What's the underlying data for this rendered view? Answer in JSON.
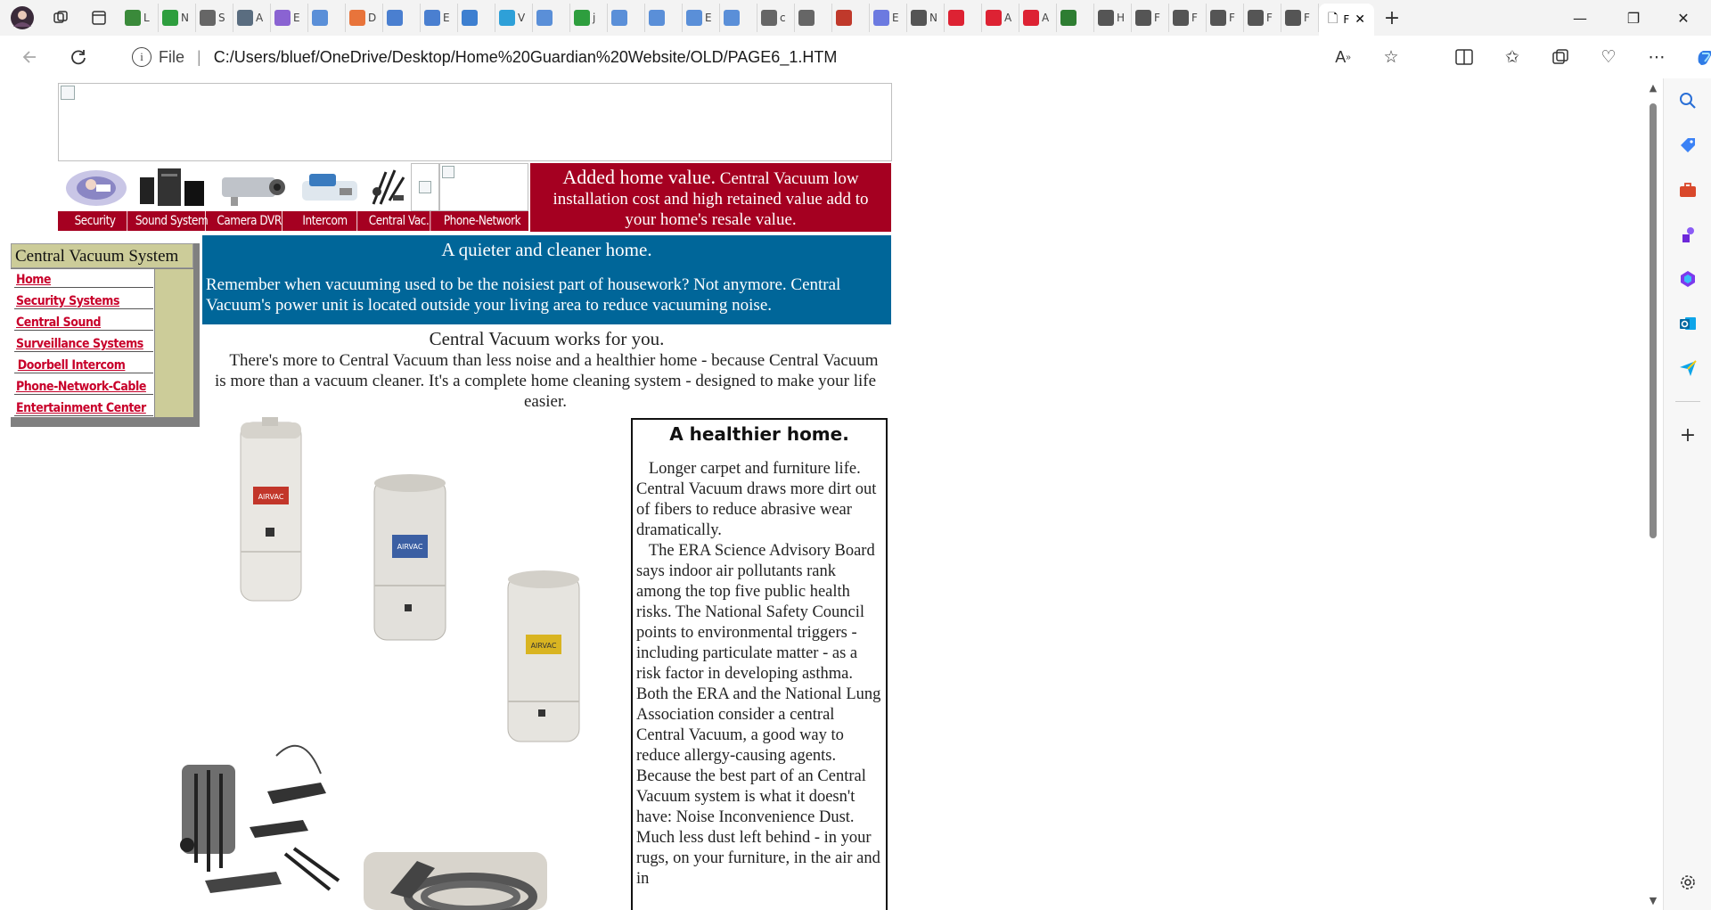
{
  "browser": {
    "tabs_collapsed": [
      "L",
      "N",
      "S",
      "A",
      "E",
      "",
      "D",
      "",
      "E",
      "",
      "V",
      "",
      "j",
      "",
      "",
      "E",
      "",
      "c",
      "",
      "",
      "E",
      "N",
      "",
      "A",
      "A",
      "",
      "H",
      "F",
      "F",
      "F",
      "F",
      "F",
      "F"
    ],
    "active_tab": {
      "title": "F"
    },
    "new_tab_label": "+",
    "file_label": "File",
    "url": "C:/Users/bluef/OneDrive/Desktop/Home%20Guardian%20Website/OLD/PAGE6_1.HTM",
    "window_controls": {
      "minimize": "—",
      "restore": "❐",
      "close": "✕"
    }
  },
  "page": {
    "nav_labels": [
      "Security",
      "Sound System",
      "Camera DVR",
      "Intercom",
      "Central Vac.",
      "Phone-Network"
    ],
    "value_box": {
      "lead": "Added home value.",
      "text": "Central Vacuum low installation cost and high retained value add to your home's resale value."
    },
    "left_menu": {
      "title": "Central Vacuum System",
      "items": [
        "Home",
        "Security Systems",
        "Central Sound",
        "Surveillance Systems",
        "Doorbell Intercom",
        "Phone-Network-Cable",
        "Entertainment Center"
      ]
    },
    "quiet": {
      "heading": "A quieter and cleaner home.",
      "text": "Remember when vacuuming used to be the noisiest part of housework?  Not anymore. Central Vacuum's power unit is located outside your living area to reduce vacuuming noise."
    },
    "works": {
      "heading": "Central Vacuum works for you.",
      "text": "There's more to Central Vacuum than less noise and a healthier home - because Central Vacuum is more than a vacuum cleaner.  It's a complete home cleaning system - designed to make your life easier."
    },
    "healthier": {
      "title": "A healthier home.",
      "p1": "Longer carpet and furniture life. Central Vacuum draws more dirt out of fibers to reduce abrasive wear dramatically.",
      "p2": "The ERA Science Advisory Board says indoor air pollutants rank among the top five public health risks. The National Safety Council points to environmental triggers - including particulate matter - as a risk factor in developing asthma.",
      "p3": "Both the ERA and the National Lung Association consider a central Central Vacuum, a good way to reduce allergy-causing agents. Because the best part of an Central Vacuum system is what it doesn't have: Noise Inconvenience Dust.   Much less dust left behind - in your rugs, on your furniture, in the air and in"
    },
    "unit_labels": [
      "AIRVAC",
      "AIRVAC",
      "AIRVAC"
    ]
  }
}
